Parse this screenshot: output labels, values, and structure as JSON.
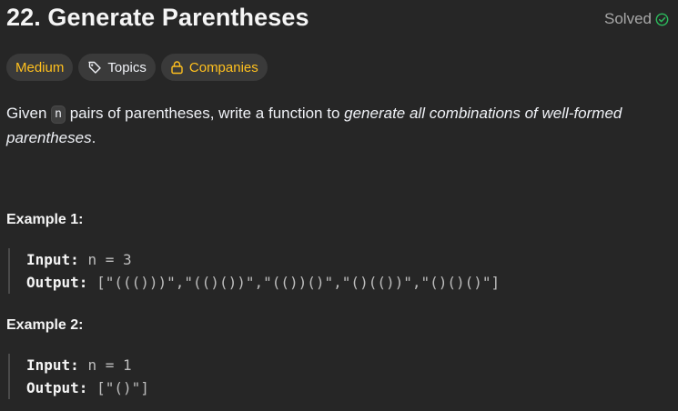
{
  "problem": {
    "title": "22. Generate Parentheses",
    "status": "Solved"
  },
  "tags": {
    "difficulty": "Medium",
    "topics": "Topics",
    "companies": "Companies"
  },
  "description": {
    "part1": "Given ",
    "code": "n",
    "part2": " pairs of parentheses, write a function to ",
    "emphasis": "generate all combinations of well-formed parentheses",
    "part3": "."
  },
  "examples": [
    {
      "title": "Example 1:",
      "input_label": "Input:",
      "input_value": "n = 3",
      "output_label": "Output:",
      "output_value": "[\"((()))\",\"(()())\",\"(())()\",\"()(())\",\"()()()\"]"
    },
    {
      "title": "Example 2:",
      "input_label": "Input:",
      "input_value": "n = 1",
      "output_label": "Output:",
      "output_value": "[\"()\"]"
    }
  ],
  "colors": {
    "background": "#262626",
    "medium": "#ffc01e",
    "solved_check": "#2cbb5d"
  }
}
